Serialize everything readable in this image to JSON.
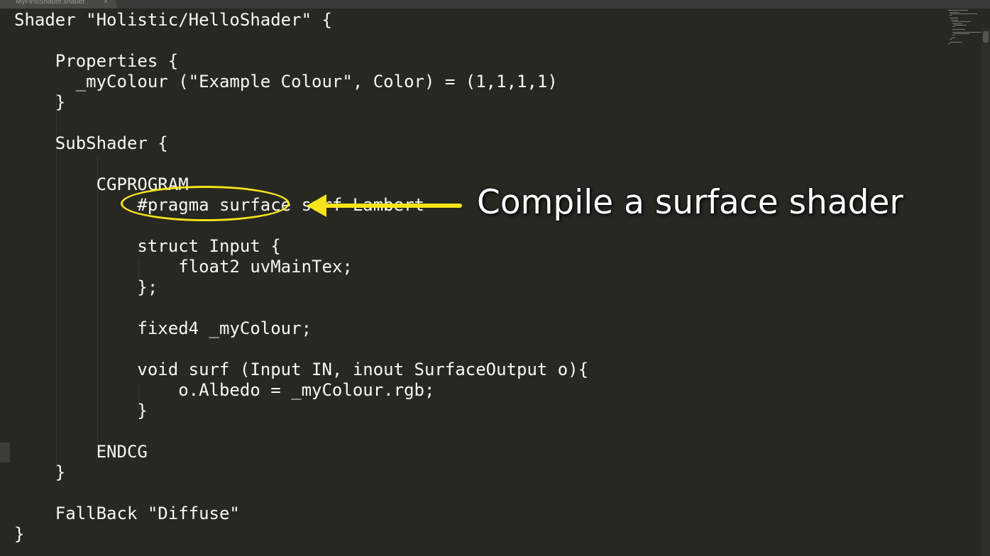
{
  "tab": {
    "label": "MyFirstShader.shader",
    "close": "×"
  },
  "code_lines": [
    "Shader \"Holistic/HelloShader\" {",
    "",
    "    Properties {",
    "      _myColour (\"Example Colour\", Color) = (1,1,1,1)",
    "    }",
    "",
    "    SubShader {",
    "",
    "        CGPROGRAM",
    "            #pragma surface surf Lambert",
    "",
    "            struct Input {",
    "                float2 uvMainTex;",
    "            };",
    "",
    "            fixed4 _myColour;",
    "",
    "            void surf (Input IN, inout SurfaceOutput o){",
    "                o.Albedo = _myColour.rgb;",
    "            }",
    "",
    "        ENDCG",
    "    }",
    "",
    "    FallBack \"Diffuse\"",
    "}"
  ],
  "annotation": {
    "text": "Compile a surface shader",
    "color": "#f6e41c"
  },
  "theme": {
    "background": "#272822",
    "foreground": "#f8f8f2"
  }
}
